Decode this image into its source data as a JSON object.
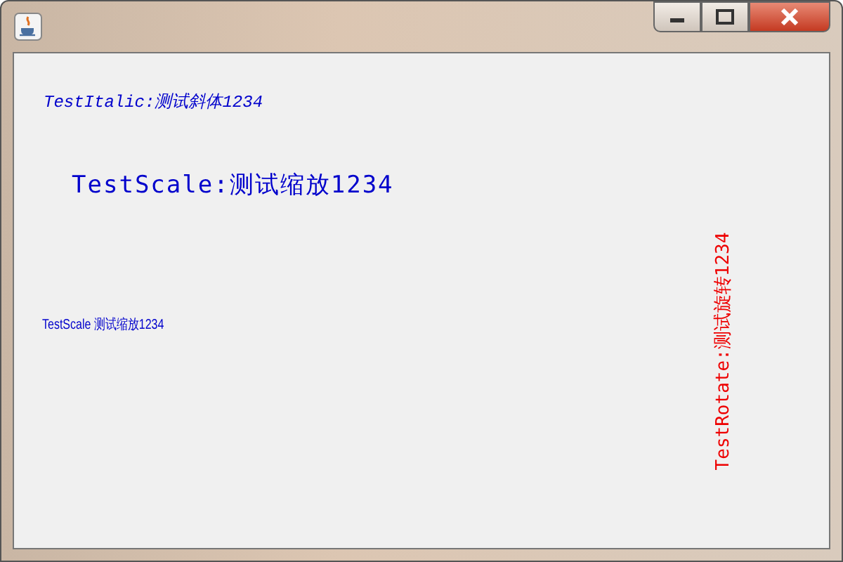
{
  "canvas_texts": [
    {
      "kind": "italic",
      "text": "TestItalic:测试斜体1234",
      "color": "#0000cc"
    },
    {
      "kind": "scaled",
      "text": "TestScale:测试缩放1234",
      "color": "#0000cc"
    },
    {
      "kind": "condensed",
      "text": "TestScale 测试缩放1234",
      "color": "#0000cc"
    },
    {
      "kind": "rotated",
      "text": "TestRotate:测试旋转1234",
      "color": "#ee0000"
    }
  ]
}
